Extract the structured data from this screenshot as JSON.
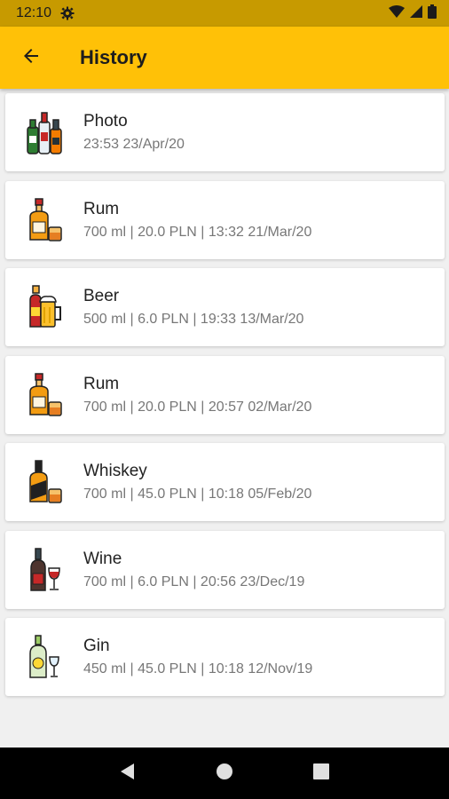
{
  "status_bar": {
    "time": "12:10",
    "icons": [
      "gear-icon",
      "wifi-icon",
      "signal-icon",
      "battery-icon"
    ]
  },
  "app_bar": {
    "title": "History",
    "back_icon": "arrow-left-icon",
    "color": "#ffc107"
  },
  "history": [
    {
      "name": "Photo",
      "meta": "23:53 23/Apr/20",
      "icon": "bottles-icon"
    },
    {
      "name": "Rum",
      "meta": "700 ml | 20.0 PLN | 13:32 21/Mar/20",
      "icon": "rum-icon"
    },
    {
      "name": "Beer",
      "meta": "500 ml | 6.0 PLN | 19:33 13/Mar/20",
      "icon": "beer-icon"
    },
    {
      "name": "Rum",
      "meta": "700 ml | 20.0 PLN | 20:57 02/Mar/20",
      "icon": "rum-icon"
    },
    {
      "name": "Whiskey",
      "meta": "700 ml | 45.0 PLN | 10:18 05/Feb/20",
      "icon": "whiskey-icon"
    },
    {
      "name": "Wine",
      "meta": "700 ml | 6.0 PLN | 20:56 23/Dec/19",
      "icon": "wine-icon"
    },
    {
      "name": "Gin",
      "meta": "450 ml | 45.0 PLN | 10:18 12/Nov/19",
      "icon": "gin-icon"
    }
  ],
  "nav_bar": {
    "icons": [
      "back-triangle-icon",
      "home-circle-icon",
      "recents-square-icon"
    ]
  }
}
